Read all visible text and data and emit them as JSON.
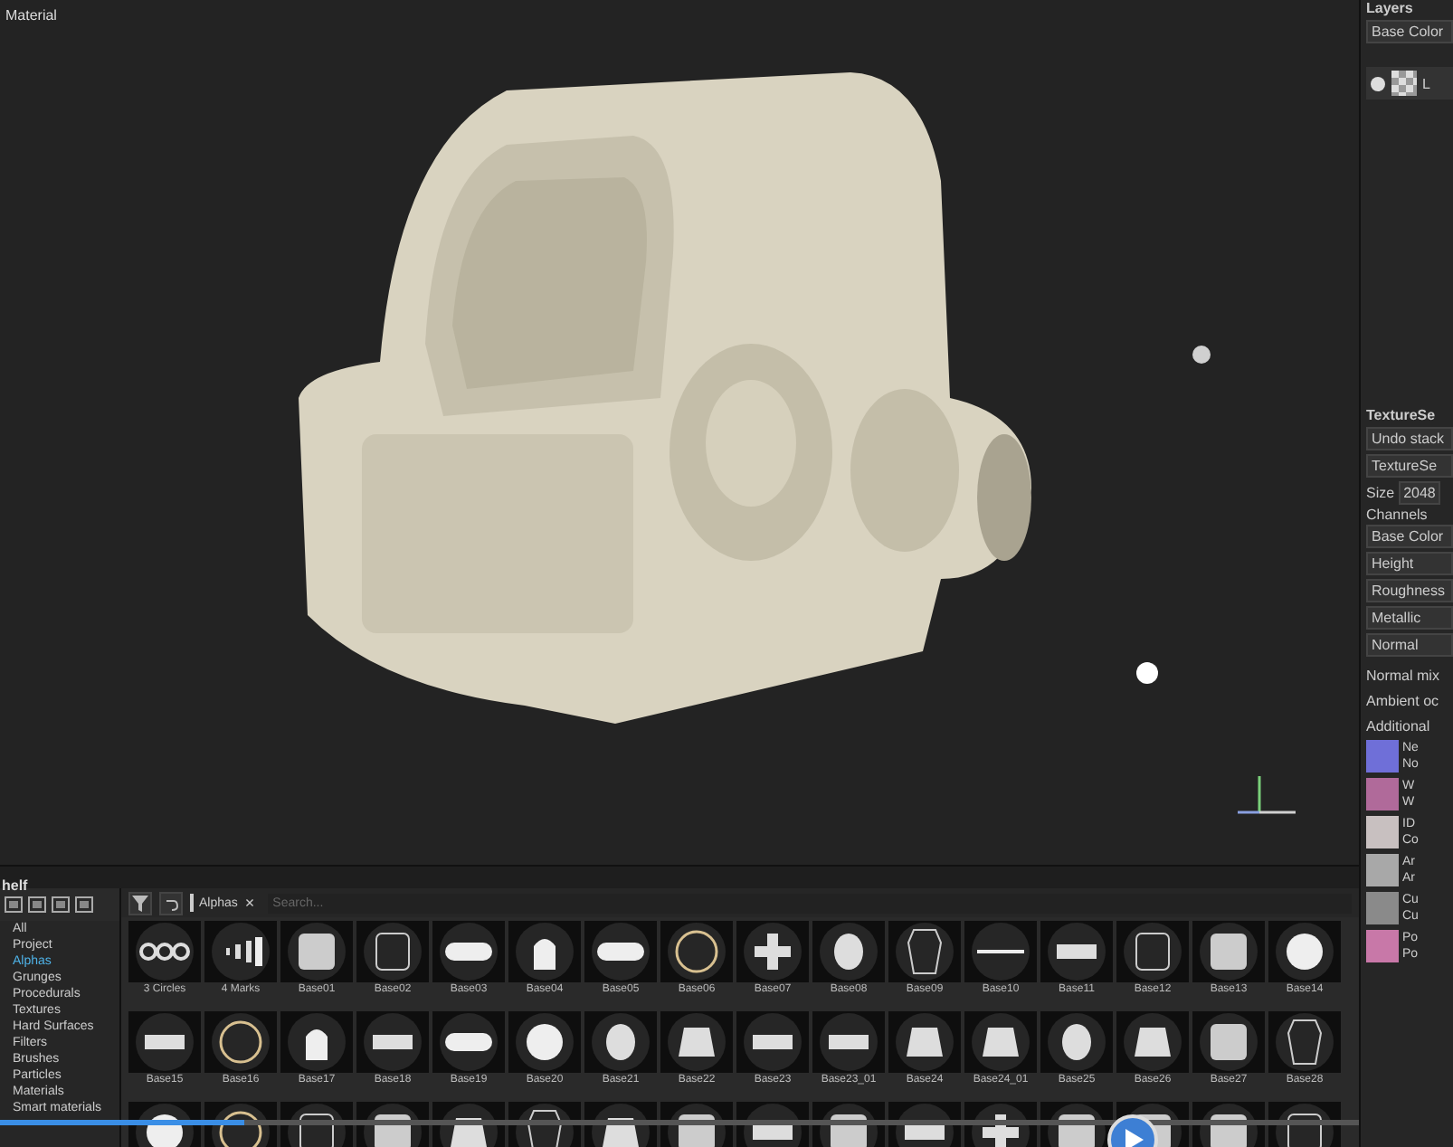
{
  "viewport": {
    "label": "Material"
  },
  "layers": {
    "title": "Layers",
    "channel": "Base Color",
    "rows": [
      {
        "name": "L",
        "visible": true
      }
    ]
  },
  "texture_set": {
    "title": "TextureSe",
    "undo": "Undo stack",
    "set": "TextureSe",
    "size_label": "Size",
    "size": "2048",
    "channels_label": "Channels",
    "channels": [
      "Base Color",
      "Height",
      "Roughness",
      "Metallic",
      "Normal"
    ],
    "options": [
      "Normal mix",
      "Ambient oc",
      "Additional"
    ],
    "maps": [
      {
        "name": "Ne",
        "sub": "No",
        "color": "#6f6fd8"
      },
      {
        "name": "W",
        "sub": "W",
        "color": "#b06a9a"
      },
      {
        "name": "ID",
        "sub": "Co",
        "color": "#c8c0c0"
      },
      {
        "name": "Ar",
        "sub": "Ar",
        "color": "#a8a8a8"
      },
      {
        "name": "Cu",
        "sub": "Cu",
        "color": "#8a8a8a"
      },
      {
        "name": "Po",
        "sub": "Po",
        "color": "#c878a8"
      }
    ]
  },
  "shelf": {
    "title": "helf",
    "categories": [
      {
        "label": "All",
        "selected": false
      },
      {
        "label": "Project",
        "selected": false
      },
      {
        "label": "Alphas",
        "selected": true
      },
      {
        "label": "Grunges",
        "selected": false
      },
      {
        "label": "Procedurals",
        "selected": false
      },
      {
        "label": "Textures",
        "selected": false
      },
      {
        "label": "Hard Surfaces",
        "selected": false
      },
      {
        "label": "Filters",
        "selected": false
      },
      {
        "label": "Brushes",
        "selected": false
      },
      {
        "label": "Particles",
        "selected": false
      },
      {
        "label": "Materials",
        "selected": false
      },
      {
        "label": "Smart materials",
        "selected": false
      }
    ],
    "filter_tag": "Alphas",
    "tag_close": "×",
    "search": {
      "placeholder": "Search..."
    },
    "items": [
      {
        "label": "3 Circles",
        "kind": "circles"
      },
      {
        "label": "4 Marks",
        "kind": "marks"
      },
      {
        "label": "Base01",
        "kind": "square"
      },
      {
        "label": "Base02",
        "kind": "frame"
      },
      {
        "label": "Base03",
        "kind": "pill"
      },
      {
        "label": "Base04",
        "kind": "arch"
      },
      {
        "label": "Base05",
        "kind": "pill"
      },
      {
        "label": "Base06",
        "kind": "ring"
      },
      {
        "label": "Base07",
        "kind": "plus"
      },
      {
        "label": "Base08",
        "kind": "oval"
      },
      {
        "label": "Base09",
        "kind": "coffin"
      },
      {
        "label": "Base10",
        "kind": "line"
      },
      {
        "label": "Base11",
        "kind": "bar"
      },
      {
        "label": "Base12",
        "kind": "frame"
      },
      {
        "label": "Base13",
        "kind": "square"
      },
      {
        "label": "Base14",
        "kind": "disc"
      },
      {
        "label": "Base15",
        "kind": "bar"
      },
      {
        "label": "Base16",
        "kind": "ring"
      },
      {
        "label": "Base17",
        "kind": "arch"
      },
      {
        "label": "Base18",
        "kind": "bar"
      },
      {
        "label": "Base19",
        "kind": "pill"
      },
      {
        "label": "Base20",
        "kind": "disc"
      },
      {
        "label": "Base21",
        "kind": "oval"
      },
      {
        "label": "Base22",
        "kind": "trapezoid"
      },
      {
        "label": "Base23",
        "kind": "bar"
      },
      {
        "label": "Base23_01",
        "kind": "bar"
      },
      {
        "label": "Base24",
        "kind": "trapezoid"
      },
      {
        "label": "Base24_01",
        "kind": "trapezoid"
      },
      {
        "label": "Base25",
        "kind": "oval"
      },
      {
        "label": "Base26",
        "kind": "trapezoid"
      },
      {
        "label": "Base27",
        "kind": "square"
      },
      {
        "label": "Base28",
        "kind": "coffin"
      },
      {
        "kind": "disc"
      },
      {
        "kind": "ring"
      },
      {
        "kind": "frame"
      },
      {
        "kind": "square"
      },
      {
        "kind": "trapezoid"
      },
      {
        "kind": "coffin"
      },
      {
        "kind": "trapezoid"
      },
      {
        "kind": "square"
      },
      {
        "kind": "bar"
      },
      {
        "kind": "square"
      },
      {
        "kind": "bar"
      },
      {
        "kind": "plus"
      },
      {
        "kind": "square"
      },
      {
        "kind": "square"
      },
      {
        "kind": "square"
      },
      {
        "kind": "frame"
      }
    ]
  },
  "player": {
    "progress": {
      "level": 0.18
    }
  }
}
